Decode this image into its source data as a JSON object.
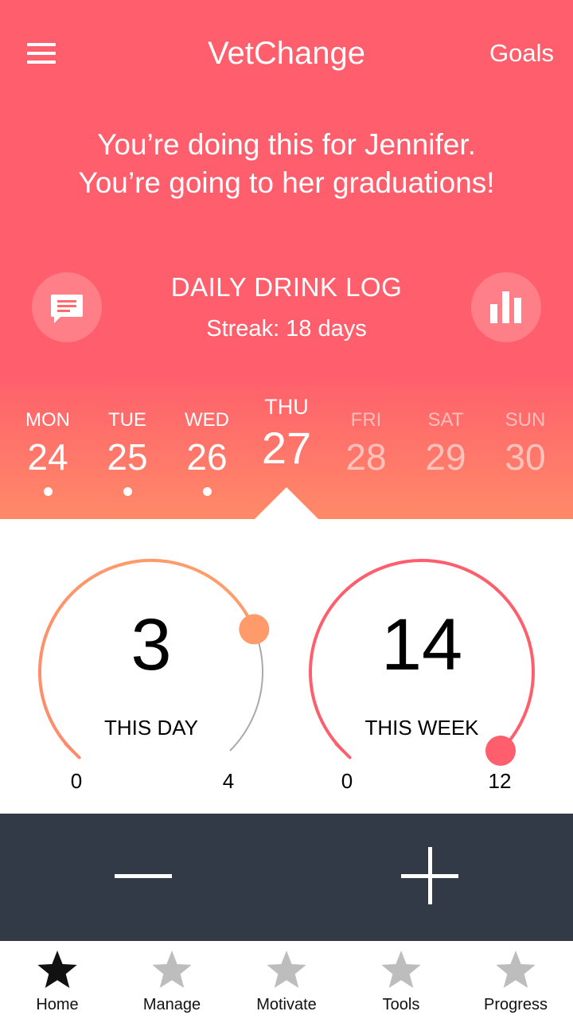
{
  "header": {
    "title": "VetChange",
    "goals_label": "Goals",
    "menu_icon": "hamburger-menu-icon"
  },
  "motivation": {
    "line1": "You’re doing this for Jennifer.",
    "line2": "You’re going to her graduations!"
  },
  "log": {
    "title": "DAILY DRINK LOG",
    "streak": "Streak: 18 days",
    "left_icon": "chat-message-icon",
    "right_icon": "bar-chart-icon"
  },
  "week": {
    "days": [
      {
        "name": "MON",
        "num": "24",
        "logged": true
      },
      {
        "name": "TUE",
        "num": "25",
        "logged": true
      },
      {
        "name": "WED",
        "num": "26",
        "logged": true
      },
      {
        "name": "THU",
        "num": "27",
        "selected": true
      },
      {
        "name": "FRI",
        "num": "28"
      },
      {
        "name": "SAT",
        "num": "29"
      },
      {
        "name": "SUN",
        "num": "30"
      }
    ]
  },
  "gauges": {
    "day": {
      "value": "3",
      "label": "THIS DAY",
      "min": "0",
      "max": "4",
      "fraction": 0.75,
      "color": "#ff9a6b"
    },
    "week": {
      "value": "14",
      "label": "THIS WEEK",
      "min": "0",
      "max": "12",
      "fraction": 1.0,
      "color": "#ff5e6c"
    }
  },
  "controls": {
    "decrement_icon": "minus-icon",
    "increment_icon": "plus-icon"
  },
  "tabs": [
    {
      "label": "Home",
      "active": true,
      "icon": "star-icon"
    },
    {
      "label": "Manage",
      "icon": "star-icon"
    },
    {
      "label": "Motivate",
      "icon": "star-icon"
    },
    {
      "label": "Tools",
      "icon": "star-icon"
    },
    {
      "label": "Progress",
      "icon": "star-icon"
    }
  ],
  "colors": {
    "accent": "#ff5e6c",
    "accent_light": "#ff9a6b",
    "dark_panel": "#323a47",
    "inactive_star": "#bdbdbd",
    "active_star": "#111111"
  }
}
